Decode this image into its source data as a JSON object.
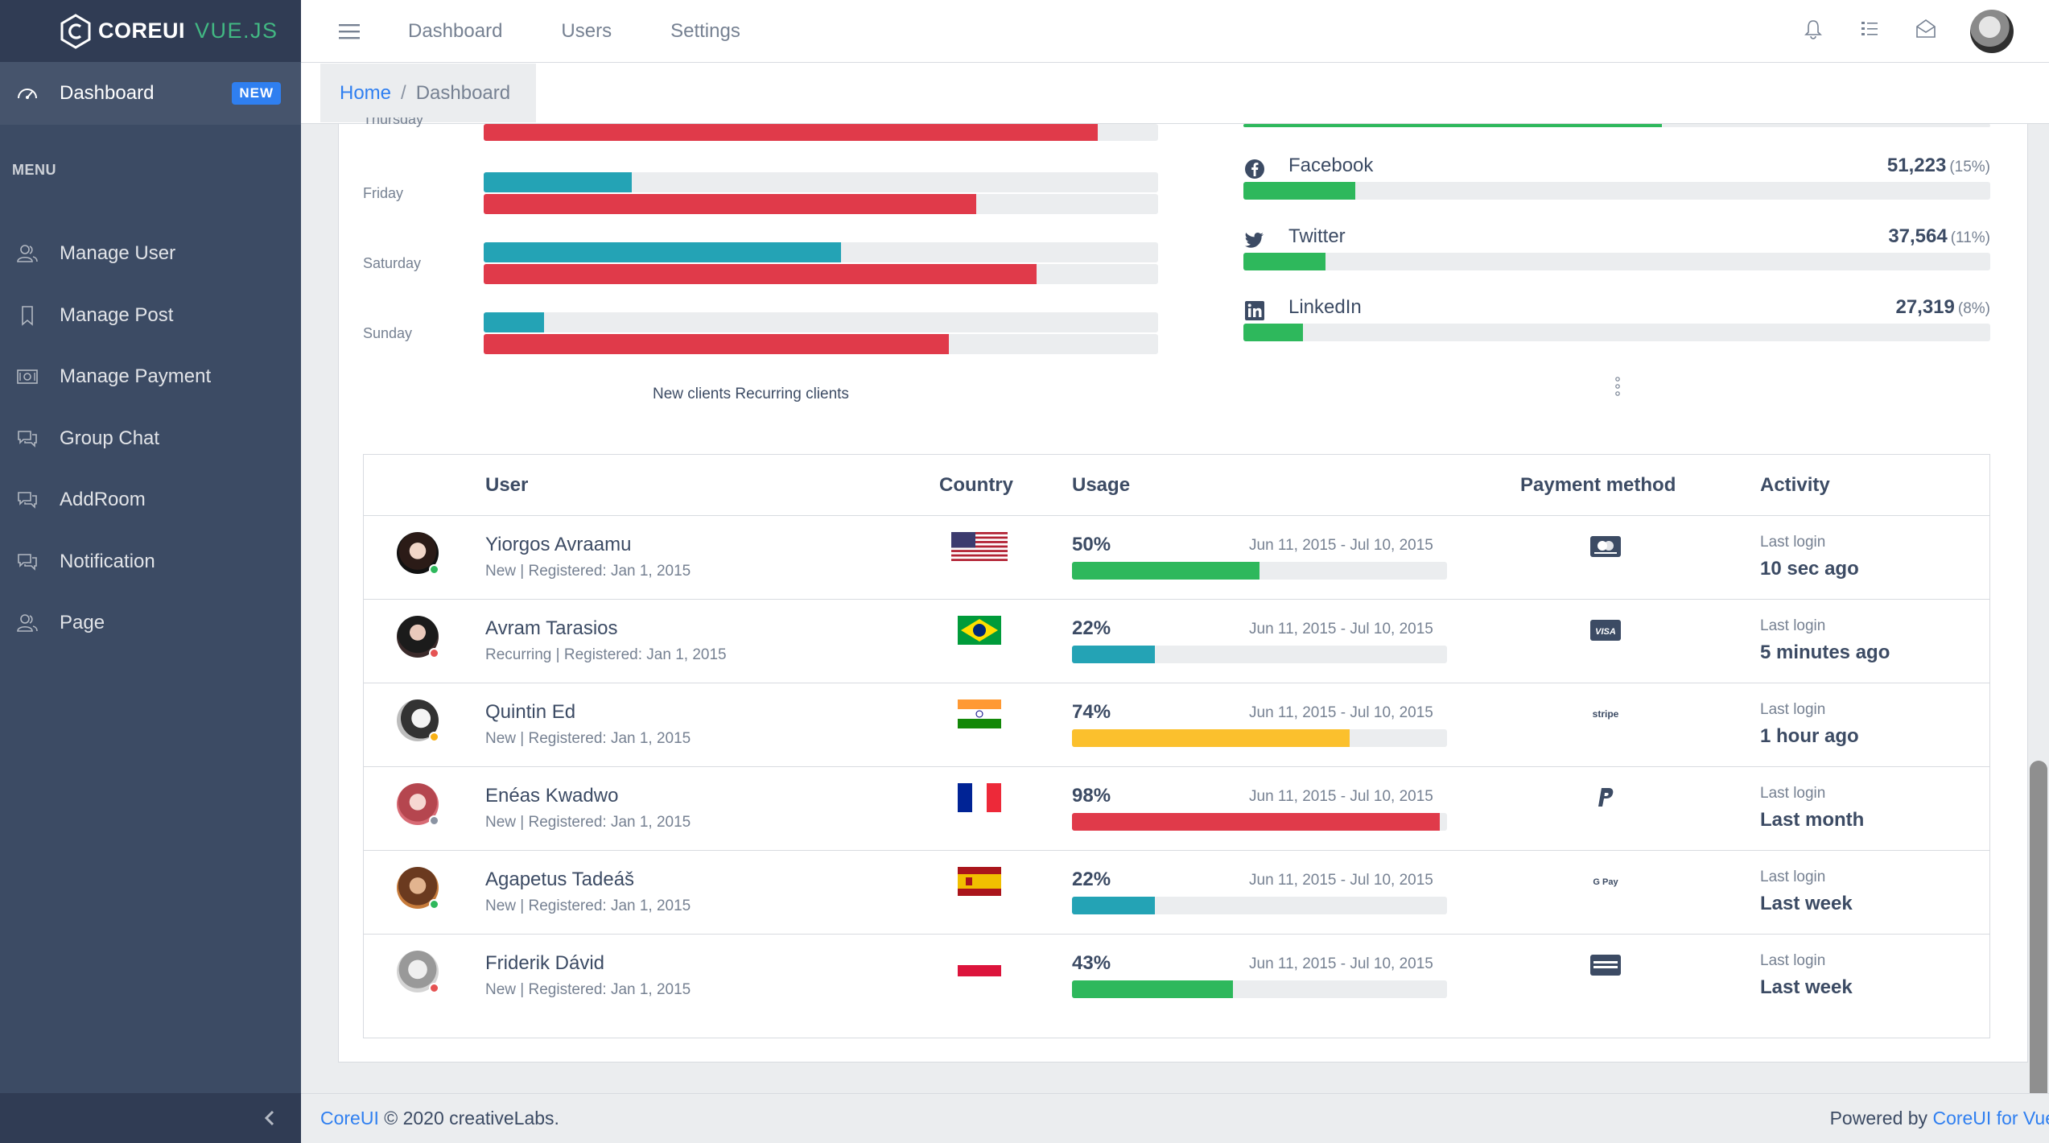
{
  "brand": {
    "core": "COREUI",
    "vue": "VUE.JS"
  },
  "sidebar": {
    "active": {
      "label": "Dashboard",
      "badge": "NEW"
    },
    "menu_title": "MENU",
    "items": [
      {
        "label": "Manage User",
        "icon": "users-icon"
      },
      {
        "label": "Manage Post",
        "icon": "bookmark-icon"
      },
      {
        "label": "Manage Payment",
        "icon": "money-icon"
      },
      {
        "label": "Group Chat",
        "icon": "chat-icon"
      },
      {
        "label": "AddRoom",
        "icon": "chat-icon"
      },
      {
        "label": "Notification",
        "icon": "chat-icon"
      },
      {
        "label": "Page",
        "icon": "users-icon"
      }
    ]
  },
  "header": {
    "nav": [
      "Dashboard",
      "Users",
      "Settings"
    ]
  },
  "breadcrumb": {
    "home": "Home",
    "separator": "/",
    "current": "Dashboard"
  },
  "traffic_by_day": {
    "days": [
      {
        "label": "Thursday",
        "new": null,
        "recurring": 91
      },
      {
        "label": "Friday",
        "new": 22,
        "recurring": 73
      },
      {
        "label": "Saturday",
        "new": 53,
        "recurring": 82
      },
      {
        "label": "Sunday",
        "new": 9,
        "recurring": 69
      }
    ],
    "legend": "New clients Recurring clients",
    "colors": {
      "new": "#24a3b5",
      "recurring": "#e03a4a"
    }
  },
  "social": [
    {
      "name": "Facebook",
      "value": "51,223",
      "pct": "(15%)",
      "fill": 15,
      "icon": "facebook-icon"
    },
    {
      "name": "Twitter",
      "value": "37,564",
      "pct": "(11%)",
      "fill": 11,
      "icon": "twitter-icon"
    },
    {
      "name": "LinkedIn",
      "value": "27,319",
      "pct": "(8%)",
      "fill": 8,
      "icon": "linkedin-icon"
    }
  ],
  "table": {
    "headers": {
      "user": "User",
      "country": "Country",
      "usage": "Usage",
      "payment": "Payment method",
      "activity": "Activity"
    },
    "rows": [
      {
        "name": "Yiorgos Avraamu",
        "meta": "New | Registered: Jan 1, 2015",
        "status": "#2eb85c",
        "flag": "us",
        "usage": "50%",
        "fill": 50,
        "color": "#2eb85c",
        "period": "Jun 11, 2015 - Jul 10, 2015",
        "payment": "mastercard-icon",
        "last_label": "Last login",
        "last": "10 sec ago"
      },
      {
        "name": "Avram Tarasios",
        "meta": "Recurring | Registered: Jan 1, 2015",
        "status": "#e55353",
        "flag": "br",
        "usage": "22%",
        "fill": 22,
        "color": "#24a3b5",
        "period": "Jun 11, 2015 - Jul 10, 2015",
        "payment": "visa-icon",
        "last_label": "Last login",
        "last": "5 minutes ago"
      },
      {
        "name": "Quintin Ed",
        "meta": "New | Registered: Jan 1, 2015",
        "status": "#f9b115",
        "flag": "in",
        "usage": "74%",
        "fill": 74,
        "color": "#fbc02d",
        "period": "Jun 11, 2015 - Jul 10, 2015",
        "payment": "stripe-icon",
        "last_label": "Last login",
        "last": "1 hour ago"
      },
      {
        "name": "Enéas Kwadwo",
        "meta": "New | Registered: Jan 1, 2015",
        "status": "#8a93a2",
        "flag": "fr",
        "usage": "98%",
        "fill": 98,
        "color": "#e03a4a",
        "period": "Jun 11, 2015 - Jul 10, 2015",
        "payment": "paypal-icon",
        "last_label": "Last login",
        "last": "Last month"
      },
      {
        "name": "Agapetus Tadeáš",
        "meta": "New | Registered: Jan 1, 2015",
        "status": "#2eb85c",
        "flag": "es",
        "usage": "22%",
        "fill": 22,
        "color": "#24a3b5",
        "period": "Jun 11, 2015 - Jul 10, 2015",
        "payment": "google-pay-icon",
        "last_label": "Last login",
        "last": "Last week"
      },
      {
        "name": "Friderik Dávid",
        "meta": "New | Registered: Jan 1, 2015",
        "status": "#e55353",
        "flag": "pl",
        "usage": "43%",
        "fill": 43,
        "color": "#2eb85c",
        "period": "Jun 11, 2015 - Jul 10, 2015",
        "payment": "amex-icon",
        "last_label": "Last login",
        "last": "Last week"
      }
    ]
  },
  "footer": {
    "left_link": "CoreUI",
    "left_text": " © 2020 creativeLabs.",
    "right_text": "Powered by ",
    "right_link": "CoreUI for Vue"
  }
}
